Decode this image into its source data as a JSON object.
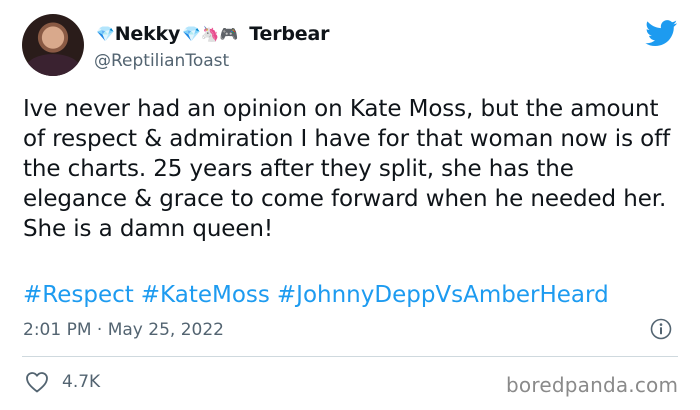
{
  "author": {
    "display_name": "Nekky",
    "display_emoji": "💎",
    "display_suffix_emoji": "💎🦄🎮",
    "display_name_2": "Terbear",
    "handle": "@ReptilianToast"
  },
  "tweet": {
    "text": "Ive never had an opinion on Kate Moss, but the amount of respect & admiration I have for that woman now is off the charts. 25 years after they split, she has the elegance & grace to come forward when he needed her. She is a damn queen!",
    "hashtags": [
      "#Respect",
      "#KateMoss",
      "#JohnnyDeppVsAmberHeard"
    ],
    "timestamp": "2:01 PM · May 25, 2022"
  },
  "stats": {
    "likes": "4.7K"
  },
  "watermark": "boredpanda.com",
  "icons": {
    "brand": "twitter-bird-icon",
    "info": "info-icon",
    "like": "heart-icon"
  },
  "colors": {
    "link": "#1d9bf0",
    "secondary_text": "#536471",
    "brand": "#1d9bf0"
  }
}
